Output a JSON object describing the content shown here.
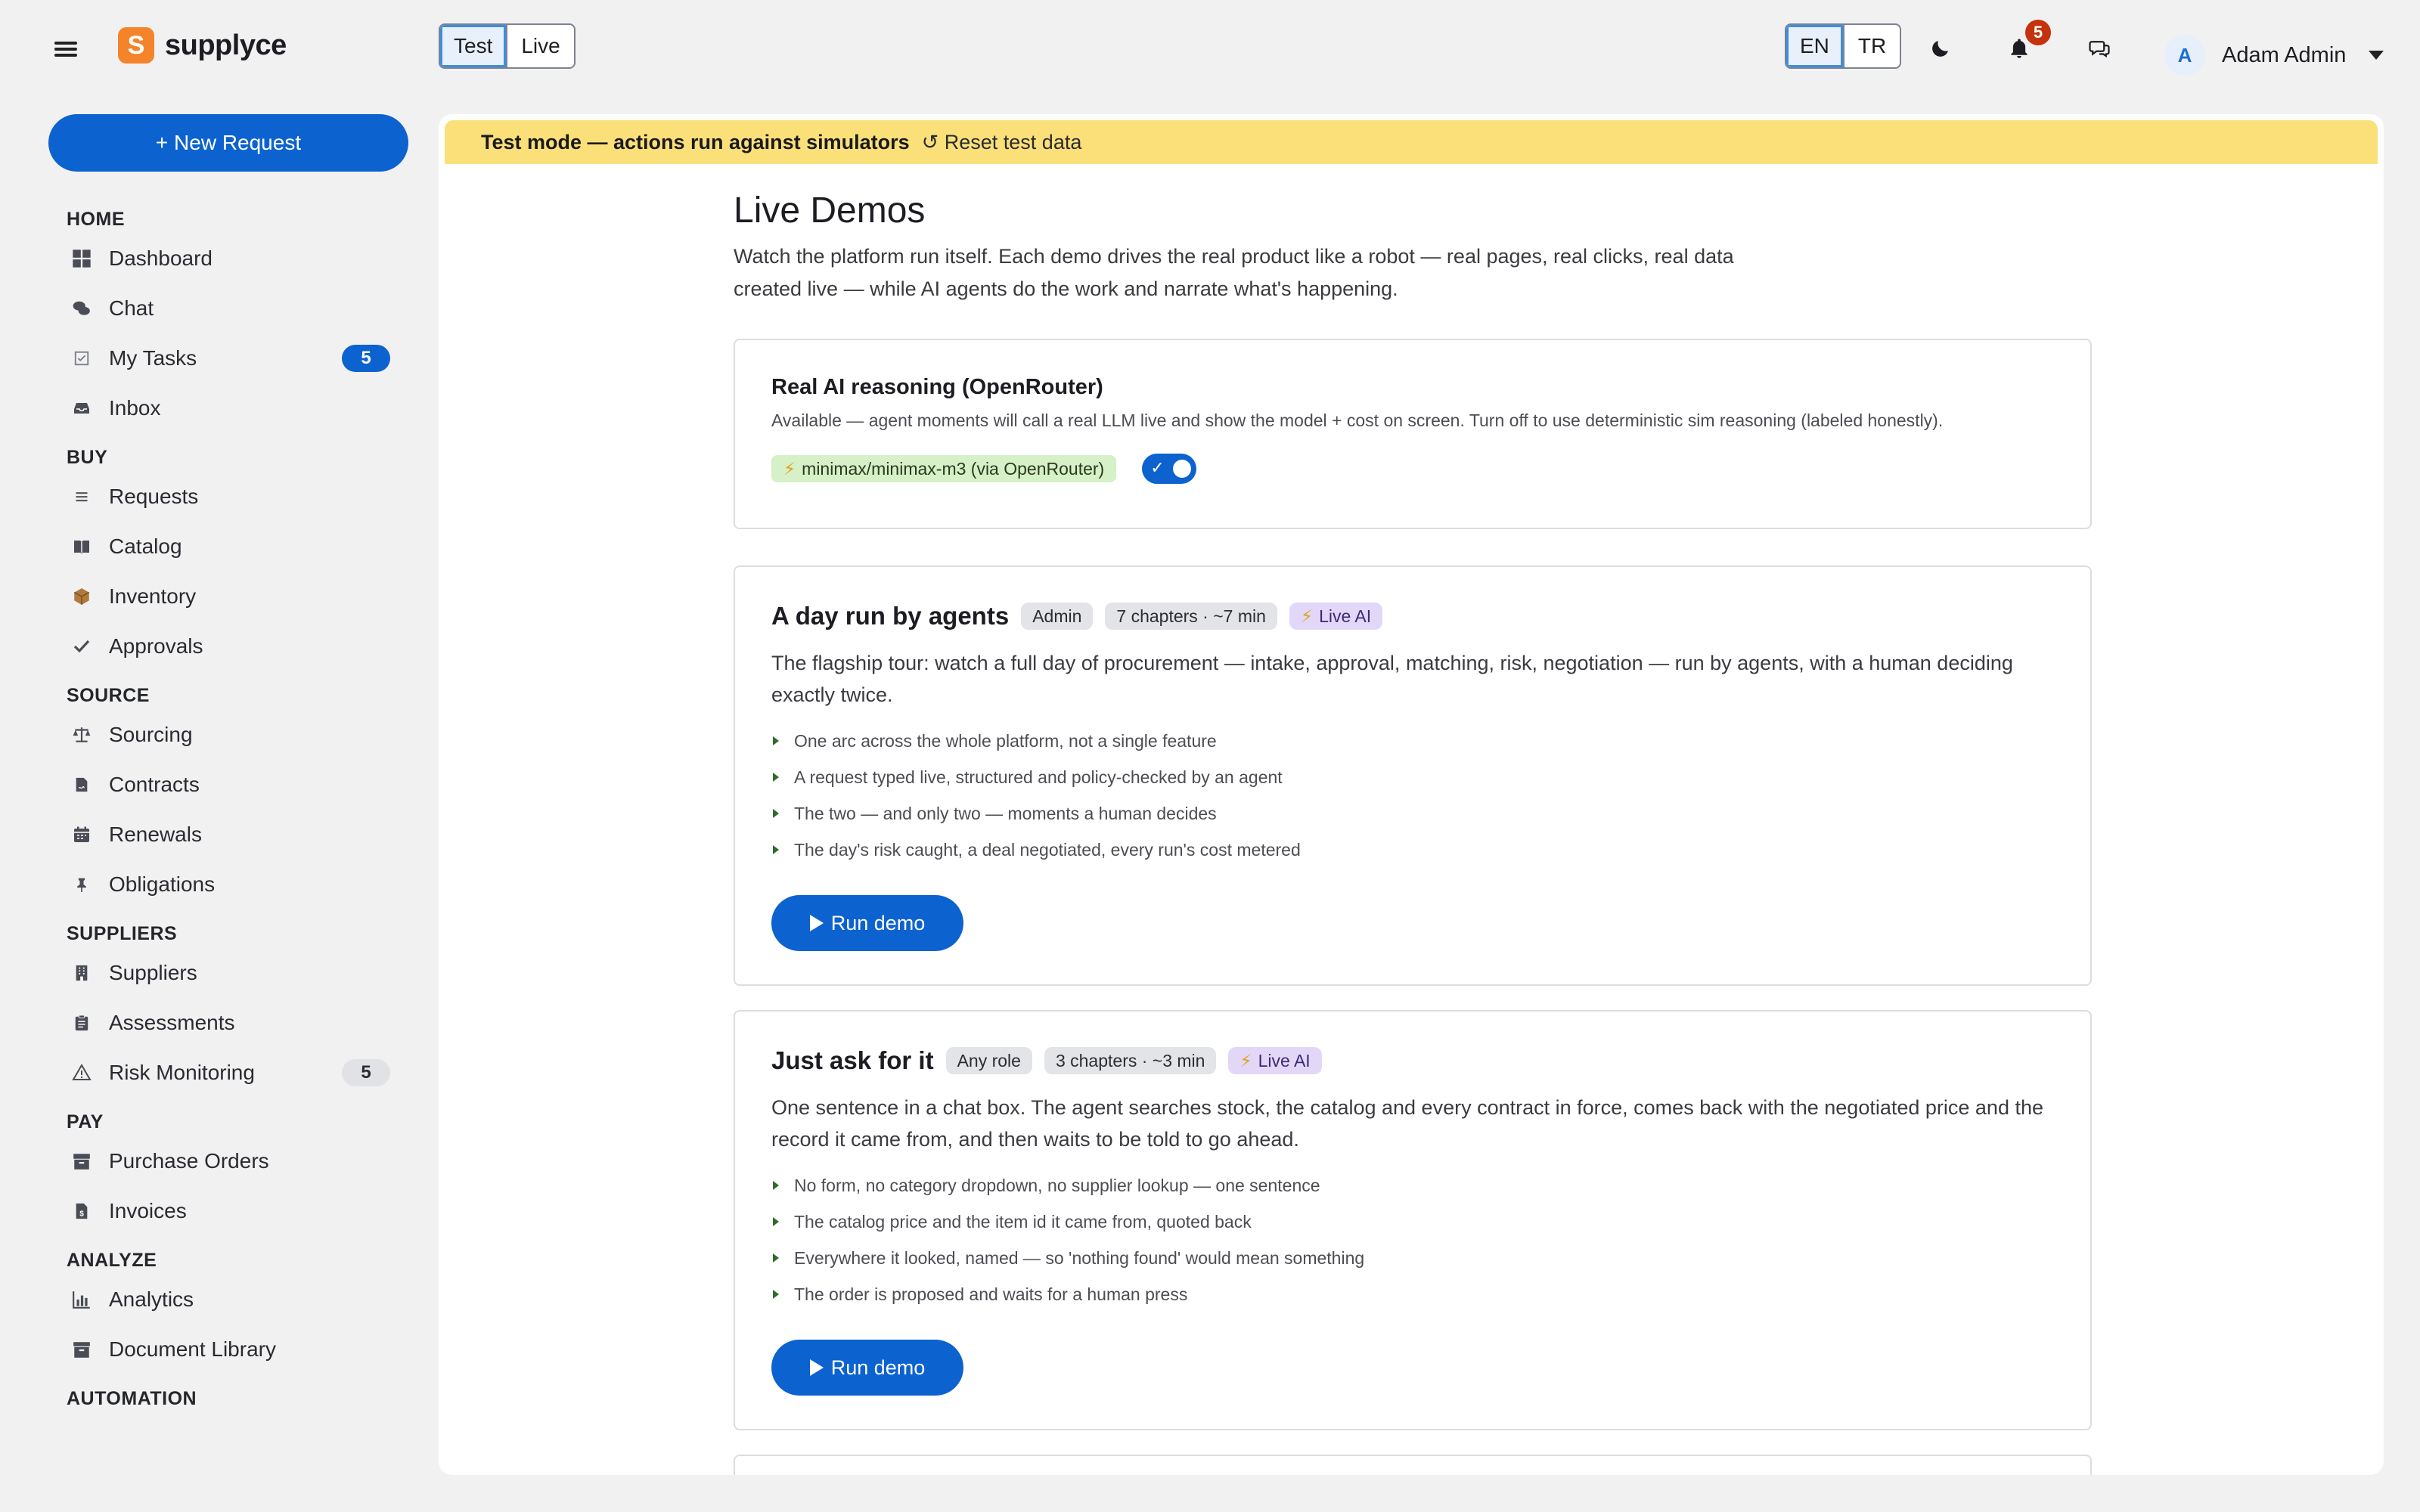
{
  "app": {
    "brand": "supplyce",
    "brand_mark": "S"
  },
  "header": {
    "mode_options": [
      {
        "label": "Test",
        "active": true
      },
      {
        "label": "Live",
        "active": false
      }
    ],
    "lang_options": [
      {
        "label": "EN",
        "active": true
      },
      {
        "label": "TR",
        "active": false
      }
    ],
    "notifications_count": "5",
    "user": {
      "initial": "A",
      "name": "Adam Admin"
    }
  },
  "sidebar": {
    "new_request_label": "+ New Request",
    "sections": [
      {
        "title": "HOME",
        "items": [
          {
            "label": "Dashboard",
            "icon": "dashboard-icon"
          },
          {
            "label": "Chat",
            "icon": "chat-bubbles-icon"
          },
          {
            "label": "My Tasks",
            "icon": "checkbox-icon",
            "badge": "5",
            "badge_style": "blue"
          },
          {
            "label": "Inbox",
            "icon": "inbox-icon"
          }
        ]
      },
      {
        "title": "BUY",
        "items": [
          {
            "label": "Requests",
            "icon": "list-icon"
          },
          {
            "label": "Catalog",
            "icon": "book-icon"
          },
          {
            "label": "Inventory",
            "icon": "box-icon"
          },
          {
            "label": "Approvals",
            "icon": "checkmark-icon"
          }
        ]
      },
      {
        "title": "SOURCE",
        "items": [
          {
            "label": "Sourcing",
            "icon": "scale-icon"
          },
          {
            "label": "Contracts",
            "icon": "contract-icon"
          },
          {
            "label": "Renewals",
            "icon": "calendar-icon"
          },
          {
            "label": "Obligations",
            "icon": "pin-icon"
          }
        ]
      },
      {
        "title": "SUPPLIERS",
        "items": [
          {
            "label": "Suppliers",
            "icon": "building-icon"
          },
          {
            "label": "Assessments",
            "icon": "clipboard-icon"
          },
          {
            "label": "Risk Monitoring",
            "icon": "warning-icon",
            "badge": "5",
            "badge_style": "grey"
          }
        ]
      },
      {
        "title": "PAY",
        "items": [
          {
            "label": "Purchase Orders",
            "icon": "archive-icon"
          },
          {
            "label": "Invoices",
            "icon": "invoice-icon"
          }
        ]
      },
      {
        "title": "ANALYZE",
        "items": [
          {
            "label": "Analytics",
            "icon": "bar-chart-icon"
          },
          {
            "label": "Document Library",
            "icon": "library-icon"
          }
        ]
      },
      {
        "title": "AUTOMATION",
        "items": []
      }
    ]
  },
  "banner": {
    "text": "Test mode — actions run against simulators",
    "reset_label": "↺ Reset test data"
  },
  "page": {
    "title": "Live Demos",
    "lead": "Watch the platform run itself. Each demo drives the real product like a robot — real pages, real clicks, real data created live — while AI agents do the work and narrate what's happening."
  },
  "ai_card": {
    "title": "Real AI reasoning (OpenRouter)",
    "description": "Available — agent moments will call a real LLM live and show the model + cost on screen. Turn off to use deterministic sim reasoning (labeled honestly).",
    "model_label": "minimax/minimax-m3 (via OpenRouter)",
    "model_icon": "⚡",
    "enabled": true
  },
  "demos": [
    {
      "title": "A day run by agents",
      "role": "Admin",
      "meta": "7 chapters · ~7 min",
      "ai_tag": "Live AI",
      "description": "The flagship tour: watch a full day of procurement — intake, approval, matching, risk, negotiation — run by agents, with a human deciding exactly twice.",
      "bullets": [
        "One arc across the whole platform, not a single feature",
        "A request typed live, structured and policy-checked by an agent",
        "The two — and only two — moments a human decides",
        "The day's risk caught, a deal negotiated, every run's cost metered"
      ],
      "button": "Run demo"
    },
    {
      "title": "Just ask for it",
      "role": "Any role",
      "meta": "3 chapters · ~3 min",
      "ai_tag": "Live AI",
      "description": "One sentence in a chat box. The agent searches stock, the catalog and every contract in force, comes back with the negotiated price and the record it came from, and then waits to be told to go ahead.",
      "bullets": [
        "No form, no category dropdown, no supplier lookup — one sentence",
        "The catalog price and the item id it came from, quoted back",
        "Everywhere it looked, named — so 'nothing found' would mean something",
        "The order is proposed and waits for a human press"
      ],
      "button": "Run demo"
    }
  ]
}
